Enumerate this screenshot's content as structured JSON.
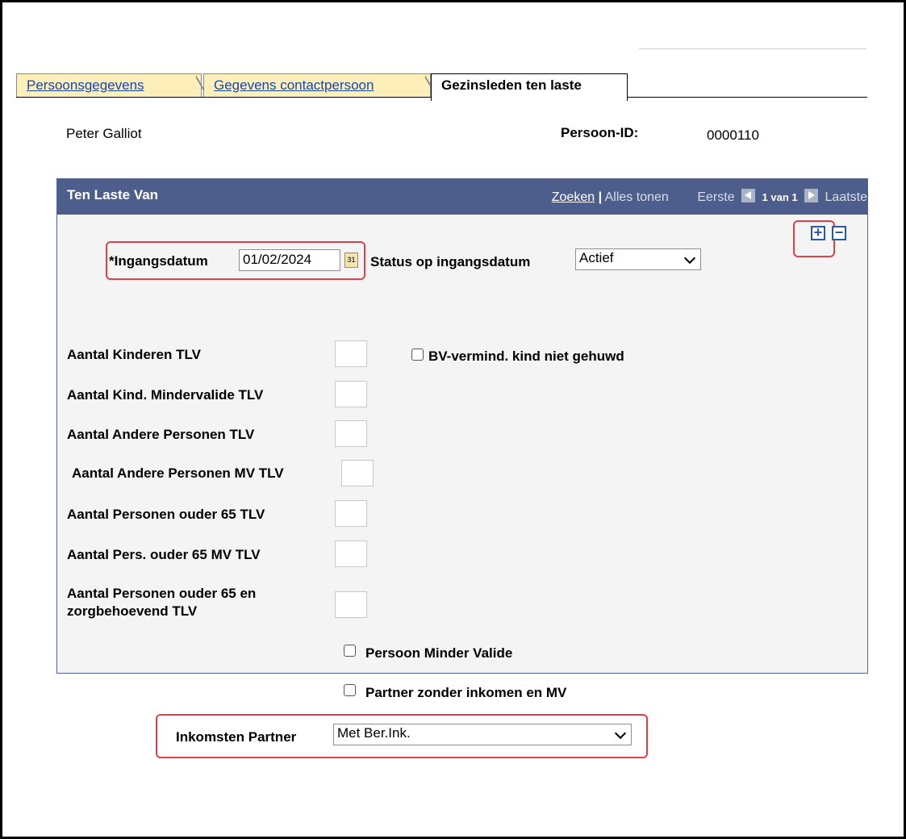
{
  "tabs": [
    "Persoonsgegevens",
    "Gegevens contactpersoon",
    "Gezinsleden ten laste"
  ],
  "header": {
    "name": "Peter Galliot",
    "persoon_id_label": "Persoon-ID:",
    "persoon_id_value": "0000110"
  },
  "panel": {
    "title": "Ten Laste Van",
    "nav": {
      "zoeken": "Zoeken",
      "sep": "|",
      "alles_tonen": "Alles tonen",
      "eerste": "Eerste",
      "count": "1 van 1",
      "laatste": "Laatste"
    },
    "add_icon": "plus-icon",
    "remove_icon": "minus-icon"
  },
  "form": {
    "ingangsdatum_label": "*Ingangsdatum",
    "ingangsdatum_value": "01/02/2024",
    "calendar_icon_text": "31",
    "status_label": "Status op ingangsdatum",
    "status_value": "Actief",
    "aantal_kinderen": "Aantal Kinderen TLV",
    "bv_vermind": "BV-vermind. kind niet gehuwd",
    "aantal_kind_mv": "Aantal Kind. Mindervalide TLV",
    "aantal_andere": "Aantal Andere Personen TLV",
    "aantal_andere_mv": "Aantal Andere Personen MV TLV",
    "aantal_ouder65": "Aantal Personen ouder 65 TLV",
    "aantal_ouder65_mv": "Aantal Pers. ouder 65 MV TLV",
    "aantal_zorg_line1": "Aantal Personen ouder 65 en",
    "aantal_zorg_line2": "zorgbehoevend TLV",
    "persoon_mv": "Persoon Minder Valide",
    "partner_zonder": "Partner zonder inkomen en MV",
    "inkomsten_label": "Inkomsten Partner",
    "inkomsten_value": "Met Ber.Ink."
  },
  "colors": {
    "panel_header": "#4d5e8c",
    "tab_inactive": "#fdefb9",
    "highlight": "#e0404a",
    "link": "#1b45a8"
  }
}
